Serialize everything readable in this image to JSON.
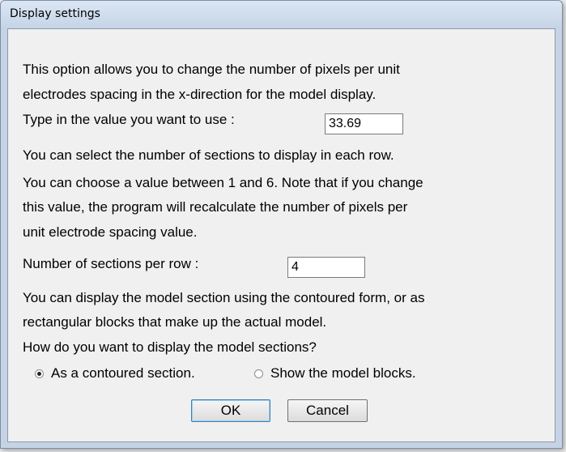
{
  "window": {
    "title": "Display settings"
  },
  "pixels_section": {
    "line1": "This option allows you to change the number of pixels per unit",
    "line2": "electrodes spacing in the x-direction for the model display.",
    "prompt": "Type in the value you want to use :",
    "value": "33.69"
  },
  "sections_section": {
    "line1": "You can select the number of sections to display in each row.",
    "line2": "You can choose a value between 1 and 6. Note that if you change",
    "line3": "this value, the program will recalculate the number of pixels per",
    "line4": "unit electrode spacing value.",
    "prompt": "Number of sections per row :",
    "value": "4"
  },
  "display_section": {
    "line1": "You can display the model section using the contoured form, or as",
    "line2": "rectangular blocks that make up the actual model.",
    "question": "How do you want to display the model sections?",
    "options": [
      {
        "label": "As a contoured section.",
        "selected": true
      },
      {
        "label": "Show the model blocks.",
        "selected": false
      }
    ]
  },
  "buttons": {
    "ok": "OK",
    "cancel": "Cancel"
  }
}
